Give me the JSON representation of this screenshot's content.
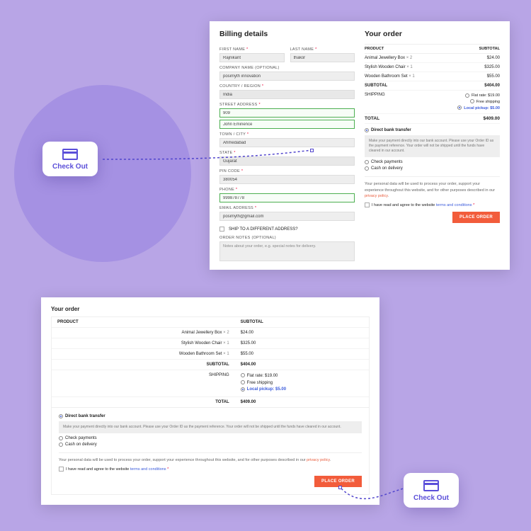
{
  "badge_label": "Check Out",
  "billing": {
    "heading": "Billing details",
    "first_name_label": "FIRST NAME",
    "first_name": "Rajnikant",
    "last_name_label": "LAST NAME",
    "last_name": "thakor",
    "company_label": "COMPANY NAME (OPTIONAL)",
    "company": "posimyth innovation",
    "country_label": "COUNTRY / REGION",
    "country": "India",
    "street_label": "STREET ADDRESS",
    "street1": "909",
    "street2": "John Eminence",
    "town_label": "TOWN / CITY",
    "town": "Ahmedabad",
    "state_label": "STATE",
    "state": "Gujarat",
    "pin_label": "PIN CODE",
    "pin": "380054",
    "phone_label": "PHONE",
    "phone": "999878778",
    "email_label": "EMAIL ADDRESS",
    "email": "posimyth@gmail.com",
    "ship_diff": "SHIP TO A DIFFERENT ADDRESS?",
    "notes_label": "ORDER NOTES (OPTIONAL)",
    "notes_ph": "Notes about your order, e.g. special notes for delivery."
  },
  "order": {
    "heading": "Your order",
    "product_hdr": "PRODUCT",
    "subtotal_hdr": "SUBTOTAL",
    "items": [
      {
        "name": "Animal Jewellery Box",
        "qty": "× 2",
        "price": "$24.00"
      },
      {
        "name": "Stylish Wooden Chair",
        "qty": "× 1",
        "price": "$325.00"
      },
      {
        "name": "Wooden Bathroom Set",
        "qty": "× 1",
        "price": "$55.00"
      }
    ],
    "subtotal_label": "SUBTOTAL",
    "subtotal": "$404.00",
    "shipping_label": "SHIPPING",
    "ship_opts": {
      "flat": "Flat rate: $19.00",
      "free": "Free shipping",
      "local": "Local pickup: $5.00"
    },
    "total_label": "TOTAL",
    "total": "$409.00"
  },
  "payment": {
    "bank": "Direct bank transfer",
    "bank_note": "Make your payment directly into our bank account. Please use your Order ID as the payment reference. Your order will not be shipped until the funds have cleared in our account.",
    "check": "Check payments",
    "cod": "Cash on delivery"
  },
  "privacy_text": "Your personal data will be used to process your order, support your experience throughout this website, and for other purposes described in our ",
  "privacy_link": "privacy policy",
  "terms_text": "I have read and agree to the website ",
  "terms_link": "terms and conditions",
  "place_order": "PLACE ORDER"
}
